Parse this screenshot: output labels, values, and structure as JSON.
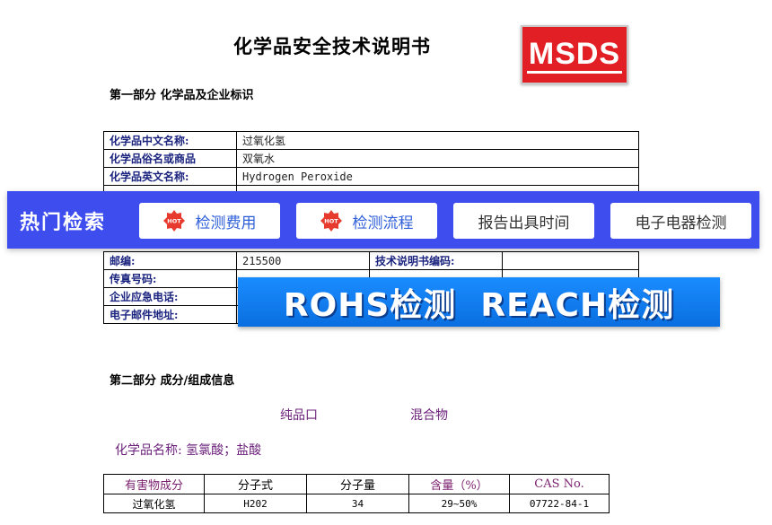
{
  "document": {
    "title": "化学品安全技术说明书",
    "logo_text": "MSDS",
    "section1_heading": "第一部分  化学品及企业标识",
    "section2_heading": "第二部分  成分/组成信息"
  },
  "identity_rows": [
    {
      "label": "化学品中文名称:",
      "value": "过氧化氢"
    },
    {
      "label": "化学品俗名或商品",
      "value": "双氧水"
    },
    {
      "label": "化学品英文名称:",
      "value": "Hydrogen Peroxide"
    }
  ],
  "company_rows": {
    "postcode_label": "邮编:",
    "postcode_value": "215500",
    "doc_code_label": "技术说明书编码:",
    "fax_label": "传真号码:",
    "emergency_label": "企业应急电话:",
    "email_label": "电子邮件地址:"
  },
  "hot_search": {
    "title": "热门检索",
    "buttons": [
      {
        "label": "检测费用",
        "hot": true
      },
      {
        "label": "检测流程",
        "hot": true
      },
      {
        "label": "报告出具时间",
        "hot": false
      },
      {
        "label": "电子电器检测",
        "hot": false
      }
    ],
    "badge_text": "HOT"
  },
  "banner": {
    "text": "ROHS检测  REACH检测"
  },
  "composition": {
    "pure_label": "纯品口",
    "mixture_label": "混合物",
    "name_line": "化学品名称: 氢氯酸；盐酸",
    "headers": [
      "有害物成分",
      "分子式",
      "分子量",
      "含量（%）",
      "CAS No."
    ],
    "rows": [
      [
        "过氧化氢",
        "H202",
        "34",
        "29~50%",
        "07722-84-1"
      ]
    ]
  },
  "colors": {
    "hot_bar": "#3e4dee",
    "badge_red": "#e63b2e",
    "logo_red": "#e21f24",
    "banner_blue": "#1a8cff"
  }
}
